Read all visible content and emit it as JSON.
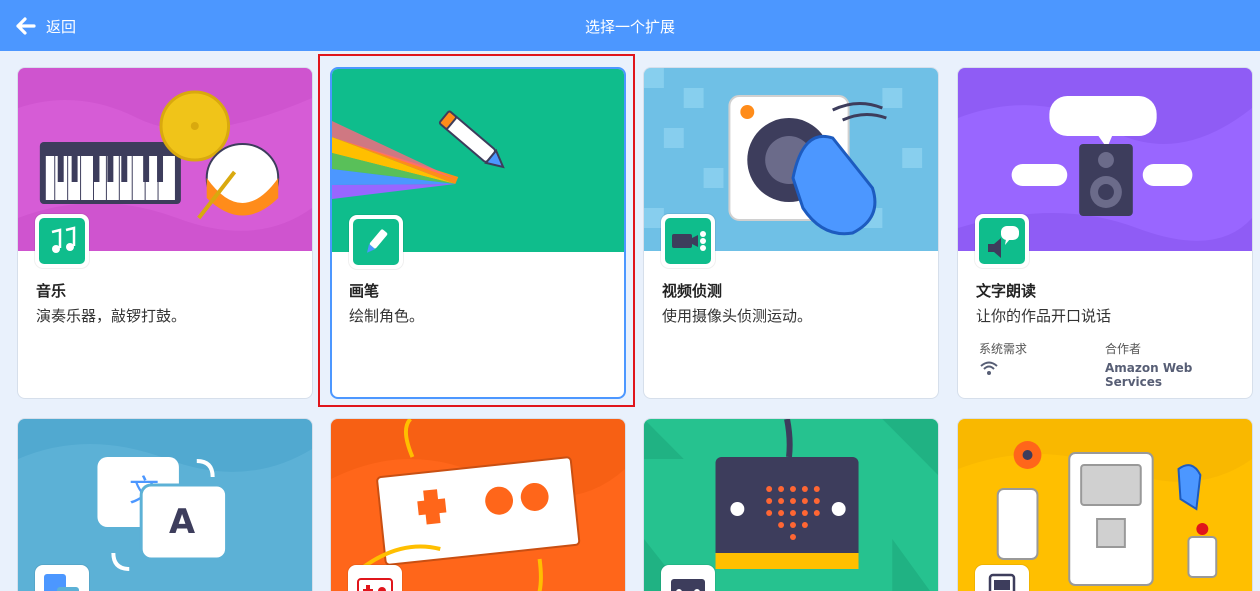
{
  "header": {
    "back_label": "返回",
    "title": "选择一个扩展"
  },
  "extensions": [
    {
      "name": "音乐",
      "description": "演奏乐器，敲锣打鼓。"
    },
    {
      "name": "画笔",
      "description": "绘制角色。",
      "selected": true
    },
    {
      "name": "视频侦测",
      "description": "使用摄像头侦测运动。"
    },
    {
      "name": "文字朗读",
      "description": "让你的作品开口说话",
      "requirements_label": "系统需求",
      "partner_label": "合作者",
      "partner": "Amazon Web Services"
    }
  ],
  "row2": [
    {
      "icon": "translate-icon"
    },
    {
      "icon": "makey-makey-icon"
    },
    {
      "icon": "microbit-icon"
    },
    {
      "icon": "lego-ev3-icon"
    }
  ],
  "colors": {
    "header": "#4c97ff",
    "background": "#e9f1fc",
    "badge": "#0fbd8c",
    "selection": "#e0151b"
  }
}
